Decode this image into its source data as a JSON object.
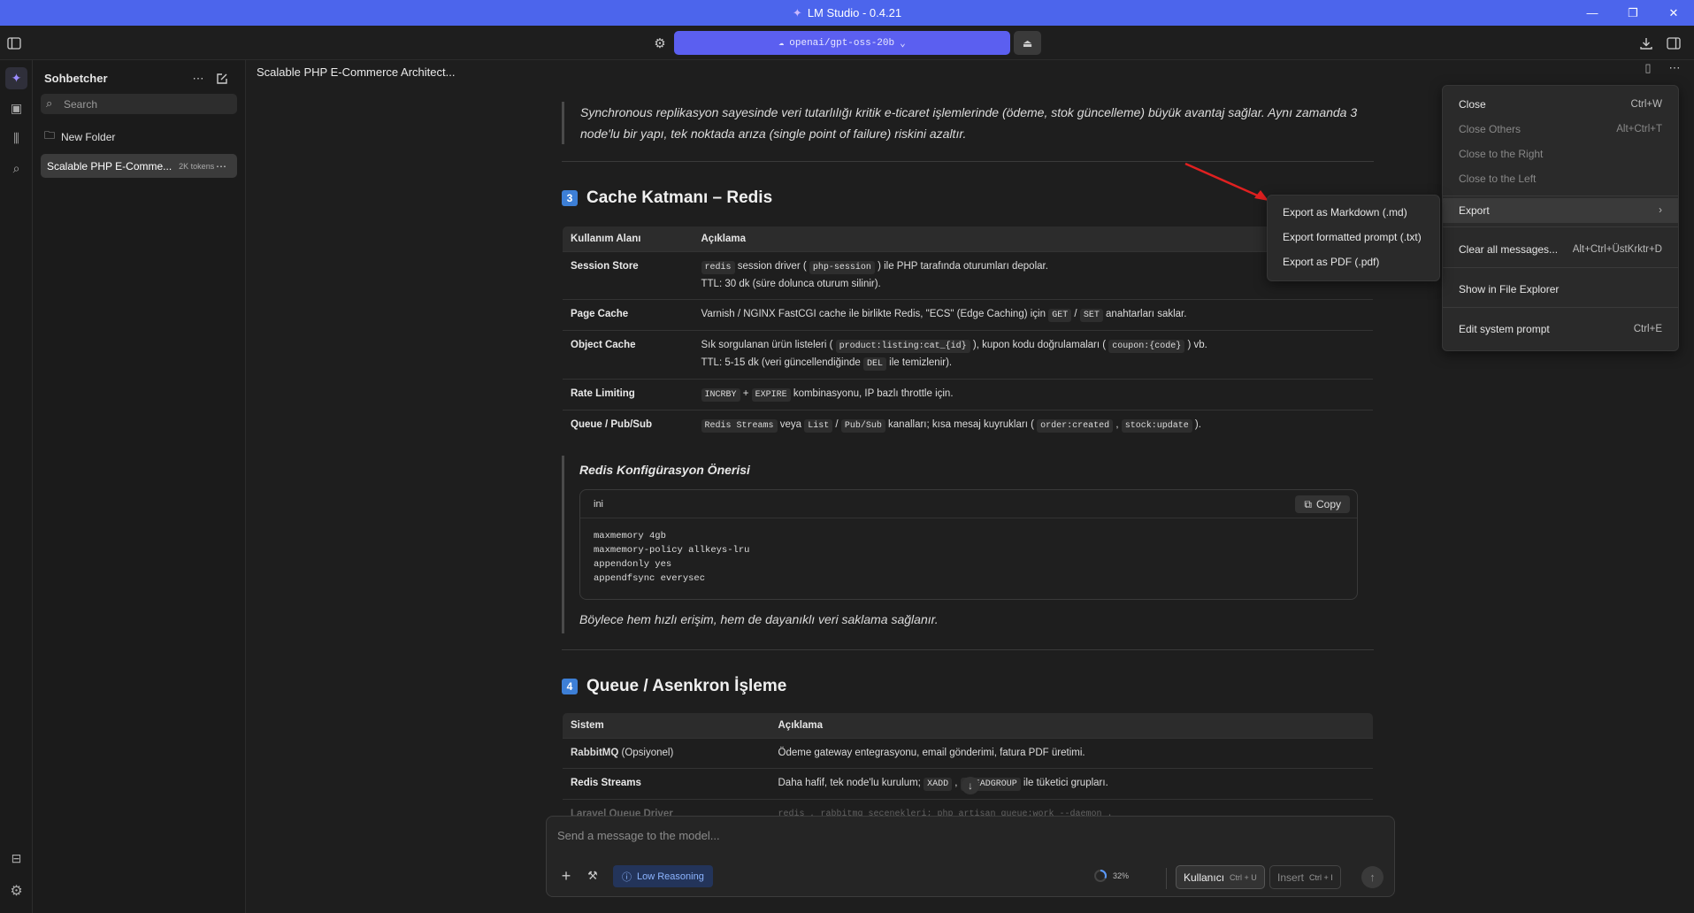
{
  "window": {
    "title": "LM Studio - 0.4.21"
  },
  "toolbar": {
    "model": "openai/gpt-oss-20b"
  },
  "sidebar": {
    "title": "Sohbetcher",
    "search_placeholder": "Search",
    "new_folder": "New Folder",
    "chat_item": "Scalable PHP E-Comme...",
    "chat_tokens": "2K tokens"
  },
  "chat": {
    "title": "Scalable PHP E-Commerce Architect..."
  },
  "content": {
    "intro_quote": "Synchronous replikasyon sayesinde veri tutarlılığı kritik e-ticaret işlemlerinde (ödeme, stok güncelleme) büyük avantaj sağlar. Aynı zamanda 3 node'lu bir yapı, tek noktada arıza (single point of failure) riskini azaltır.",
    "section3": {
      "num": "3",
      "title": "Cache Katmanı – Redis"
    },
    "table1": {
      "headers": [
        "Kullanım Alanı",
        "Açıklama"
      ],
      "rows": [
        {
          "k": "Session Store",
          "c1": "redis",
          "t1": " session driver ( ",
          "c2": "php-session",
          "t2": " ) ile PHP tarafında oturumları depolar.",
          "line2": "TTL: 30 dk (süre dolunca oturum silinir)."
        },
        {
          "k": "Page Cache",
          "t1": "Varnish / NGINX FastCGI cache ile birlikte Redis, \"ECS\" (Edge Caching) için ",
          "c1": "GET",
          "t2": " / ",
          "c2": "SET",
          "t3": " anahtarları saklar."
        },
        {
          "k": "Object Cache",
          "t1": "Sık sorgulanan ürün listeleri ( ",
          "c1": "product:listing:cat_{id}",
          "t2": " ), kupon kodu doğrulamaları ( ",
          "c2": "coupon:{code}",
          "t3": " ) vb.",
          "line2a": "TTL: 5-15 dk (veri güncellendiğinde ",
          "c3": "DEL",
          "line2b": " ile temizlenir)."
        },
        {
          "k": "Rate Limiting",
          "c1": "INCRBY",
          "t1": " + ",
          "c2": "EXPIRE",
          "t2": " kombinasyonu, IP bazlı throttle için."
        },
        {
          "k": "Queue / Pub/Sub",
          "c1": "Redis Streams",
          "t1": " veya ",
          "c2": "List",
          "t2": " / ",
          "c3": "Pub/Sub",
          "t3": " kanalları; kısa mesaj kuyrukları ( ",
          "c4": "order:created",
          "t4": " , ",
          "c5": "stock:update",
          "t5": " )."
        }
      ]
    },
    "redis_config": {
      "subtitle": "Redis Konfigürasyon Önerisi",
      "lang": "ini",
      "copy": "Copy",
      "code": "maxmemory 4gb\nmaxmemory-policy allkeys-lru\nappendonly yes\nappendfsync everysec",
      "after": "Böylece hem hızlı erişim, hem de dayanıklı veri saklama sağlanır."
    },
    "section4": {
      "num": "4",
      "title": "Queue / Asenkron İşleme"
    },
    "table2": {
      "headers": [
        "Sistem",
        "Açıklama"
      ],
      "rows": [
        {
          "k": "RabbitMQ",
          "kx": " (Opsiyonel)",
          "t1": "Ödeme gateway entegrasyonu, email gönderimi, fatura PDF üretimi."
        },
        {
          "k": "Redis Streams",
          "t1": "Daha hafif, tek node'lu kurulum; ",
          "c1": "XADD",
          "t2": " , ",
          "c2": "XREADGROUP",
          "t3": " ile tüketici grupları."
        },
        {
          "k": "Laravel Queue Driver",
          "t1": "redis , rabbitmq seçenekleri; php artisan queue:work --daemon ."
        }
      ]
    }
  },
  "composer": {
    "placeholder": "Send a message to the model...",
    "reasoning": "Low Reasoning",
    "progress": "32%",
    "user_btn": "Kullanıcı",
    "user_kb": "Ctrl + U",
    "insert_btn": "Insert",
    "insert_kb": "Ctrl + I"
  },
  "context_menu": {
    "items": [
      {
        "label": "Close",
        "shortcut": "Ctrl+W"
      },
      {
        "label": "Close Others",
        "shortcut": "Alt+Ctrl+T"
      },
      {
        "label": "Close to the Right",
        "shortcut": ""
      },
      {
        "label": "Close to the Left",
        "shortcut": ""
      },
      {
        "label": "Export",
        "shortcut": "›"
      },
      {
        "label": "Clear all messages...",
        "shortcut": "Alt+Ctrl+ÜstKrktr+D"
      },
      {
        "label": "Show in File Explorer",
        "shortcut": ""
      },
      {
        "label": "Edit system prompt",
        "shortcut": "Ctrl+E"
      }
    ]
  },
  "export_menu": {
    "items": [
      "Export as Markdown (.md)",
      "Export formatted prompt (.txt)",
      "Export as PDF (.pdf)"
    ]
  },
  "colors": {
    "accent": "#4c65ec",
    "model_pill": "#5b5ff0",
    "arrow": "#e02020"
  }
}
